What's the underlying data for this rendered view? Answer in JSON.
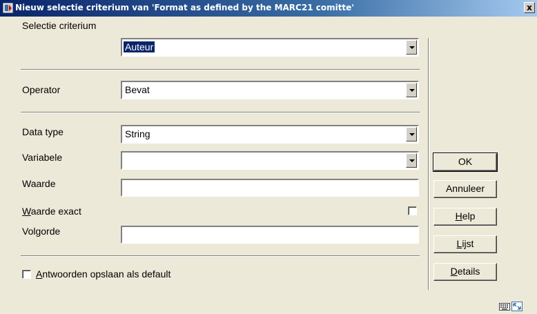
{
  "window": {
    "title": "Nieuw selectie criterium van 'Format as defined by the MARC21 comitte'",
    "close_label": "x"
  },
  "form": {
    "selectie_criterium": {
      "label": "Selectie criterium",
      "value": "Auteur"
    },
    "operator": {
      "label": "Operator",
      "value": "Bevat"
    },
    "data_type": {
      "label": "Data type",
      "value": "String"
    },
    "variabele": {
      "label": "Variabele",
      "value": ""
    },
    "waarde": {
      "label": "Waarde",
      "value": ""
    },
    "waarde_exact": {
      "label_mnemonic": "W",
      "label_rest": "aarde exact",
      "checked": false
    },
    "volgorde": {
      "label": "Volgorde",
      "value": ""
    },
    "antwoorden": {
      "label_mnemonic": "A",
      "label_rest": "ntwoorden opslaan als default",
      "checked": false
    }
  },
  "buttons": {
    "ok": "OK",
    "annuleer": "Annuleer",
    "help_mnemonic": "H",
    "help_rest": "elp",
    "lijst_mnemonic": "L",
    "lijst_rest": "ijst",
    "details_mnemonic": "D",
    "details_rest": "etails"
  },
  "icons": {
    "app": "app-icon",
    "keyboard": "keyboard-icon",
    "resize": "resize-icon"
  },
  "colors": {
    "titlebar_start": "#0a246a",
    "titlebar_end": "#a6caf0",
    "dialog_bg": "#ece9d8",
    "selection": "#0a246a"
  }
}
